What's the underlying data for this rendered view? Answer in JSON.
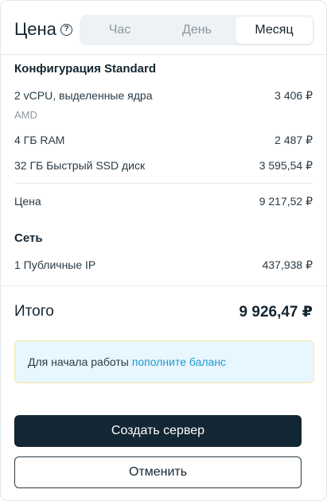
{
  "header": {
    "title": "Цена",
    "help_icon": "?",
    "tabs": [
      {
        "label": "Час",
        "active": false
      },
      {
        "label": "День",
        "active": false
      },
      {
        "label": "Месяц",
        "active": true
      }
    ]
  },
  "config": {
    "title": "Конфигурация Standard",
    "items": [
      {
        "label": "2 vCPU, выделенные ядра",
        "value": "3 406 ₽",
        "sub": "AMD"
      },
      {
        "label": "4 ГБ RAM",
        "value": "2 487 ₽"
      },
      {
        "label": "32 ГБ Быстрый SSD диск",
        "value": "3 595,54 ₽"
      }
    ],
    "price_label": "Цена",
    "price_value": "9 217,52 ₽"
  },
  "network": {
    "title": "Сеть",
    "items": [
      {
        "label": "1 Публичные IP",
        "value": "437,938 ₽"
      }
    ]
  },
  "total": {
    "label": "Итого",
    "value": "9 926,47 ₽"
  },
  "notice": {
    "text": "Для начала работы",
    "link": "пополните баланс"
  },
  "actions": {
    "create": "Создать сервер",
    "cancel": "Отменить"
  },
  "colors": {
    "primary_button": "#122633",
    "link": "#1e9ad6",
    "notice_bg": "#e8f6fd",
    "notice_border": "#f3e7a8"
  }
}
